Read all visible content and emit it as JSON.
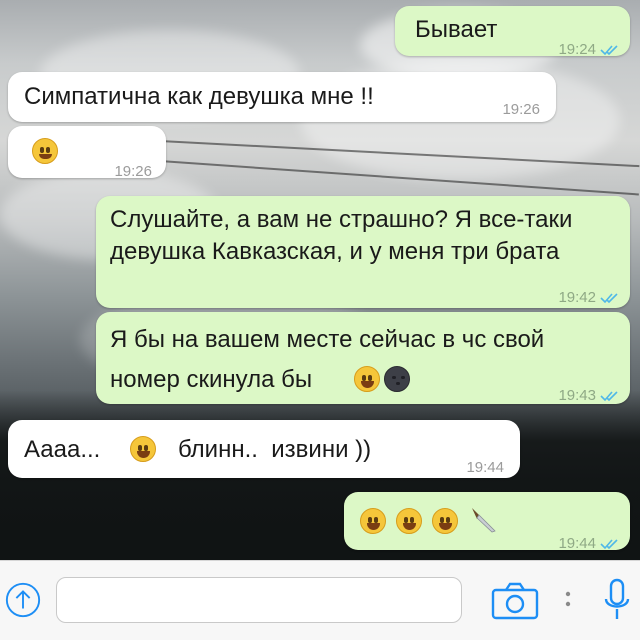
{
  "chat": {
    "messages": [
      {
        "dir": "out",
        "text": "Бывает",
        "time": "19:24",
        "read": true
      },
      {
        "dir": "in",
        "text": "Симпатична как девушка мне !!",
        "time": "19:26"
      },
      {
        "dir": "in",
        "text": "",
        "emoji": "winking-face",
        "time": "19:26"
      },
      {
        "dir": "out",
        "text": "Слушайте, а вам не страшно? Я все-таки девушка Кавказская, и у меня три брата",
        "time": "19:42",
        "read": true
      },
      {
        "dir": "out",
        "text": "Я бы на вашем месте сейчас в чс свой номер скинула бы",
        "emoji": [
          "face-with-tears-of-joy",
          "new-moon-face"
        ],
        "time": "19:43",
        "read": true
      },
      {
        "dir": "in",
        "text_before": "Аааа...",
        "emoji": "grinning-face",
        "text_after": "блинн..  извини ))",
        "time": "19:44"
      },
      {
        "dir": "out",
        "text": "",
        "emoji": [
          "grinning-squinting-face",
          "grinning-squinting-face",
          "grinning-squinting-face",
          "kitchen-knife"
        ],
        "time": "19:44",
        "read": true
      }
    ]
  },
  "composer": {
    "message_placeholder": ""
  },
  "colors": {
    "outgoing_bubble": "#dcf8c6",
    "incoming_bubble": "#ffffff",
    "read_ticks": "#4fb8e8",
    "icon_blue": "#1d8ef5"
  }
}
